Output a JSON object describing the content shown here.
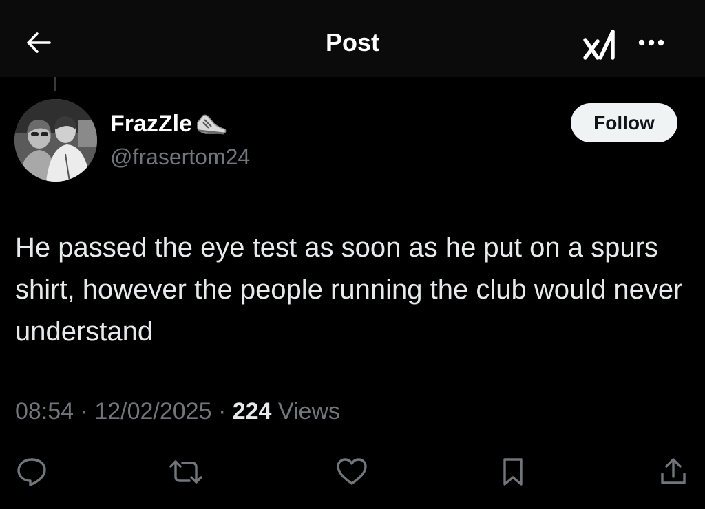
{
  "header": {
    "title": "Post",
    "back_icon": "arrow-left-icon",
    "grok_icon": "grok-icon",
    "more_icon": "more-horizontal-icon"
  },
  "author": {
    "display_name": "FrazZle",
    "name_emoji": "sneaker-icon",
    "handle": "@frasertom24",
    "follow_label": "Follow"
  },
  "post": {
    "text": "He passed the eye test as soon as he put on a spurs shirt, however the people running the club would never understand"
  },
  "meta": {
    "time": "08:54",
    "separator": "·",
    "date": "12/02/2025",
    "views_count": "224",
    "views_label": "Views"
  },
  "actions": [
    {
      "icon": "reply-icon"
    },
    {
      "icon": "repost-icon"
    },
    {
      "icon": "like-icon"
    },
    {
      "icon": "bookmark-icon"
    },
    {
      "icon": "share-icon"
    }
  ],
  "colors": {
    "background": "#000000",
    "header_background": "#0b0b0b",
    "primary_text": "#e7e9ea",
    "secondary_text": "#71767b",
    "follow_button_bg": "#eff3f4"
  }
}
